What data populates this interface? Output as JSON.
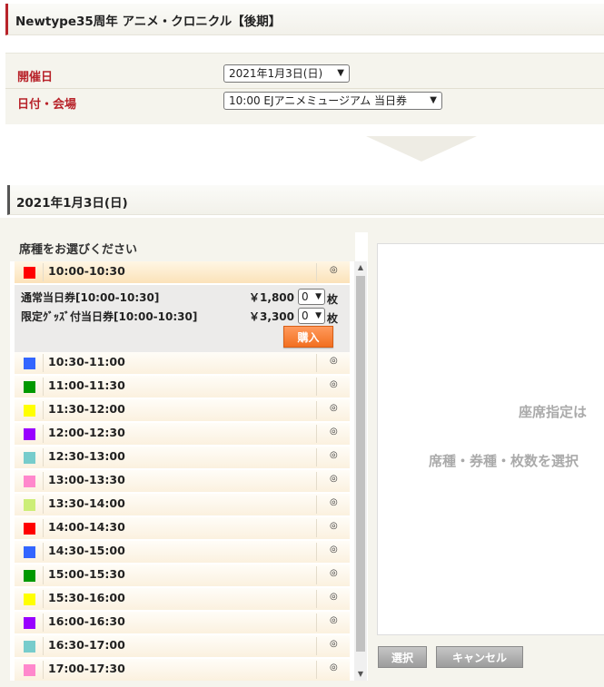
{
  "page_title": "Newtype35周年 アニメ・クロニクル【後期】",
  "conditions": {
    "date_label": "開催日",
    "date_value": "2021年1月3日(日)",
    "venue_label": "日付・会場",
    "venue_value": "10:00 EJアニメミュージアム 当日券"
  },
  "selected_date": "2021年1月3日(日)",
  "seat_section": {
    "heading": "席種をお選びください",
    "availability_mark": "◎",
    "open_slot": {
      "tickets": [
        {
          "name": "通常当日券[10:00-10:30]",
          "price": "￥1,800",
          "qty": "0",
          "unit": "枚"
        },
        {
          "name": "限定ｸﾞｯｽﾞ付当日券[10:00-10:30]",
          "price": "￥3,300",
          "qty": "0",
          "unit": "枚"
        }
      ],
      "buy_label": "購入"
    },
    "slots": [
      {
        "time": "10:00-10:30",
        "color": "#ff0000"
      },
      {
        "time": "10:30-11:00",
        "color": "#3366ff"
      },
      {
        "time": "11:00-11:30",
        "color": "#009900"
      },
      {
        "time": "11:30-12:00",
        "color": "#ffff00"
      },
      {
        "time": "12:00-12:30",
        "color": "#9900ff"
      },
      {
        "time": "12:30-13:00",
        "color": "#77cccc"
      },
      {
        "time": "13:00-13:30",
        "color": "#ff88cc"
      },
      {
        "time": "13:30-14:00",
        "color": "#ccee77"
      },
      {
        "time": "14:00-14:30",
        "color": "#ff0000"
      },
      {
        "time": "14:30-15:00",
        "color": "#3366ff"
      },
      {
        "time": "15:00-15:30",
        "color": "#009900"
      },
      {
        "time": "15:30-16:00",
        "color": "#ffff00"
      },
      {
        "time": "16:00-16:30",
        "color": "#9900ff"
      },
      {
        "time": "16:30-17:00",
        "color": "#77cccc"
      },
      {
        "time": "17:00-17:30",
        "color": "#ff88cc"
      }
    ]
  },
  "seat_map": {
    "message_line1": "座席指定は",
    "message_line2": "席種・券種・枚数を選択"
  },
  "buttons": {
    "select": "選択",
    "cancel": "キャンセル"
  }
}
